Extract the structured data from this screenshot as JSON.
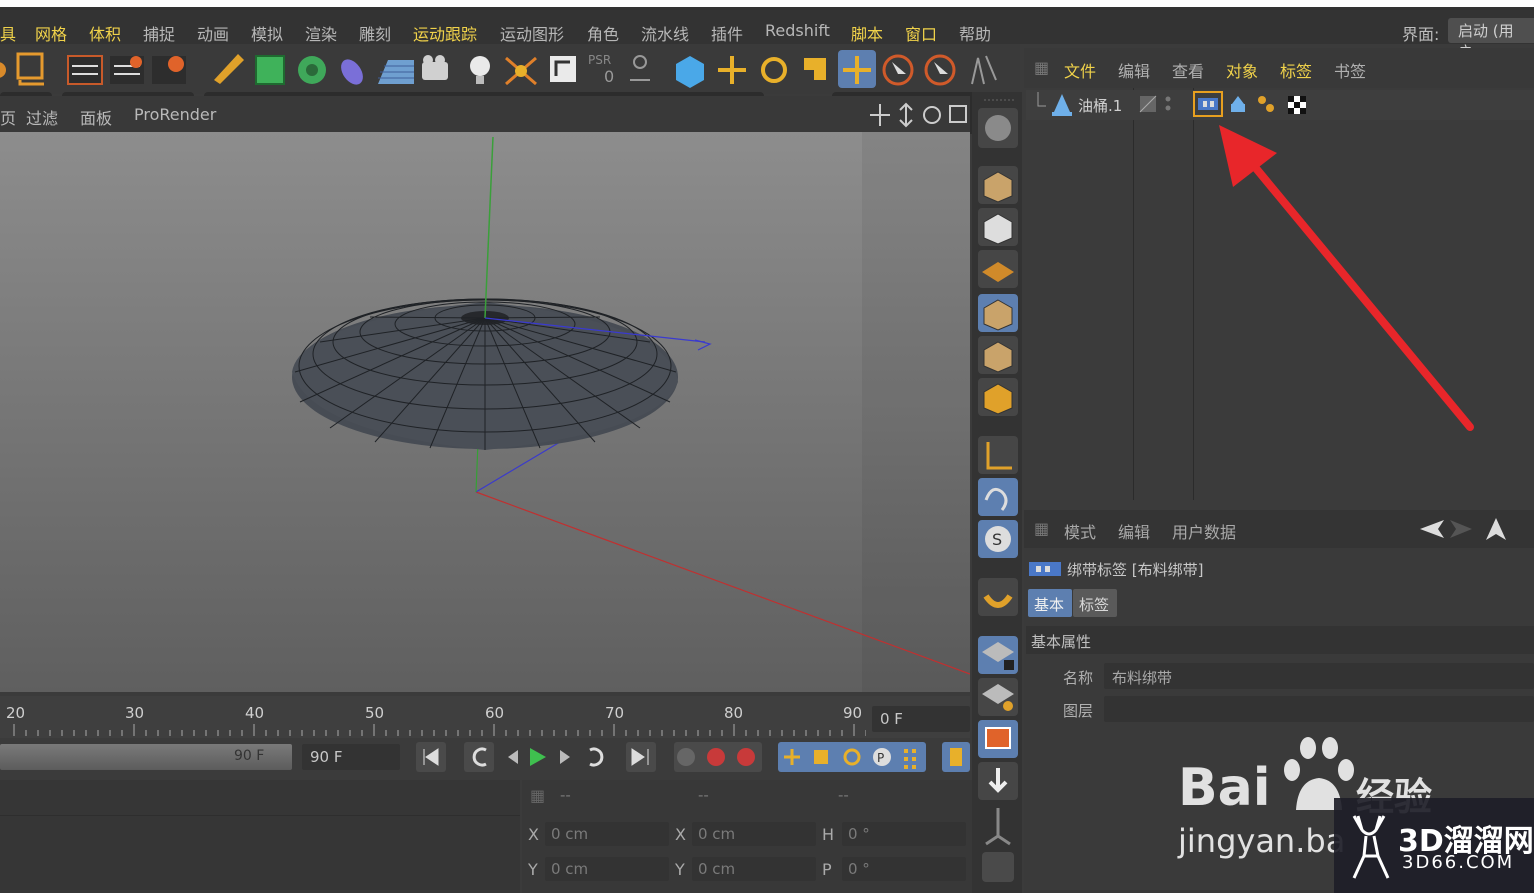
{
  "menubar": {
    "items": [
      {
        "label": "具",
        "hl": true
      },
      {
        "label": "网格",
        "hl": true
      },
      {
        "label": "体积",
        "hl": true
      },
      {
        "label": "捕捉",
        "hl": false
      },
      {
        "label": "动画",
        "hl": false
      },
      {
        "label": "模拟",
        "hl": false
      },
      {
        "label": "渲染",
        "hl": false
      },
      {
        "label": "雕刻",
        "hl": false
      },
      {
        "label": "运动跟踪",
        "hl": true
      },
      {
        "label": "运动图形",
        "hl": false
      },
      {
        "label": "角色",
        "hl": false
      },
      {
        "label": "流水线",
        "hl": false
      },
      {
        "label": "插件",
        "hl": false
      },
      {
        "label": "Redshift",
        "hl": false
      },
      {
        "label": "脚本",
        "hl": true
      },
      {
        "label": "窗口",
        "hl": true
      },
      {
        "label": "帮助",
        "hl": false
      }
    ],
    "layout_label": "界面:",
    "layout_value": "启动 (用户"
  },
  "viewport_menu": {
    "items": [
      "页",
      "过滤",
      "面板",
      "ProRender"
    ]
  },
  "object_manager": {
    "menu": [
      {
        "label": "文件",
        "hl": true
      },
      {
        "label": "编辑",
        "hl": false
      },
      {
        "label": "查看",
        "hl": false
      },
      {
        "label": "对象",
        "hl": true
      },
      {
        "label": "标签",
        "hl": true
      },
      {
        "label": "书签",
        "hl": false
      }
    ],
    "object_name": "油桶.1"
  },
  "attribute_manager": {
    "menu": [
      "模式",
      "编辑",
      "用户数据"
    ],
    "title": "绑带标签 [布料绑带]",
    "tabs": [
      "基本",
      "标签"
    ],
    "section": "基本属性",
    "fields": {
      "name_label": "名称",
      "name_value": "布料绑带",
      "layer_label": "图层",
      "layer_value": ""
    }
  },
  "timeline": {
    "ticks": [
      "20",
      "30",
      "40",
      "50",
      "60",
      "70",
      "80",
      "90"
    ],
    "current_frame": "0 F"
  },
  "playback": {
    "end_frame_slider": "90 F",
    "end_frame": "90 F"
  },
  "coordinates": {
    "headers": [
      "--",
      "--",
      "--"
    ],
    "rows": [
      {
        "l1": "X",
        "v1": "0 cm",
        "l2": "X",
        "v2": "0 cm",
        "l3": "H",
        "v3": "0 °"
      },
      {
        "l1": "Y",
        "v1": "0 cm",
        "l2": "Y",
        "v2": "0 cm",
        "l3": "P",
        "v3": "0 °"
      }
    ]
  },
  "watermarks": {
    "baidu_text": "Bai",
    "baidu_text2": "经验",
    "baidu_url": "jingyan.ba",
    "site_name": "3D溜溜网",
    "site_url": "3D66.COM"
  },
  "colors": {
    "highlight_menu": "#f0d24a",
    "arrow_red": "#e8262a",
    "axis_green": "#3fa33f",
    "axis_blue": "#3a3ad0",
    "axis_red": "#c83a3a"
  }
}
